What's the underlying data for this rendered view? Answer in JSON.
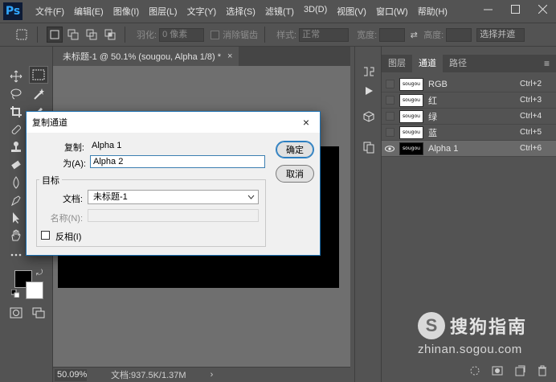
{
  "app": {
    "logo": "Ps",
    "menus": [
      "文件(F)",
      "编辑(E)",
      "图像(I)",
      "图层(L)",
      "文字(Y)",
      "选择(S)",
      "滤镜(T)",
      "3D(D)",
      "视图(V)",
      "窗口(W)",
      "帮助(H)"
    ],
    "window_controls": [
      "minimize-icon",
      "maximize-icon",
      "close-icon"
    ]
  },
  "options_bar": {
    "feather_label": "羽化:",
    "feather_value": "0 像素",
    "antialias_label": "消除锯齿",
    "style_label": "样式:",
    "style_value": "正常",
    "width_label": "宽度:",
    "height_label": "高度:",
    "select_mask_label": "选择并遮"
  },
  "document": {
    "tab_title": "未标题-1 @ 50.1% (sougou, Alpha 1/8) *",
    "tab_close": "×",
    "zoom": "50.09%",
    "doc_info": "文档:937.5K/1.37M",
    "status_arrow": "›"
  },
  "panel": {
    "tabs": [
      "图层",
      "通道",
      "路径"
    ],
    "active_tab": "通道",
    "menu_icon": "≡",
    "channels": [
      {
        "name": "RGB",
        "shortcut": "Ctrl+2",
        "thumb": "sougou",
        "visible": false,
        "selected": false,
        "thumb_dark": false
      },
      {
        "name": "红",
        "shortcut": "Ctrl+3",
        "thumb": "sougou",
        "visible": false,
        "selected": false,
        "thumb_dark": false
      },
      {
        "name": "绿",
        "shortcut": "Ctrl+4",
        "thumb": "sougou",
        "visible": false,
        "selected": false,
        "thumb_dark": false
      },
      {
        "name": "蓝",
        "shortcut": "Ctrl+5",
        "thumb": "sougou",
        "visible": false,
        "selected": false,
        "thumb_dark": false
      },
      {
        "name": "Alpha 1",
        "shortcut": "Ctrl+6",
        "thumb": "sougou",
        "visible": true,
        "selected": true,
        "thumb_dark": true
      }
    ]
  },
  "dialog": {
    "title": "复制通道",
    "close": "×",
    "source_label": "复制:",
    "source_value": "Alpha 1",
    "as_label": "为(A):",
    "as_value": "Alpha 2",
    "group_title": "目标",
    "document_label": "文档:",
    "document_value": "未标题-1",
    "name_label": "名称(N):",
    "invert_label": "反相(I)",
    "ok_label": "确定",
    "cancel_label": "取消"
  },
  "watermark": {
    "logo_letter": "S",
    "brand": "搜狗指南",
    "url": "zhinan.sogou.com"
  },
  "colors": {
    "ui_bg": "#535353",
    "canvas_bg": "#6f6f6f",
    "dialog_border": "#1b6fb0",
    "accent_blue": "#2c7fc1",
    "ps_blue": "#31a8ff"
  }
}
